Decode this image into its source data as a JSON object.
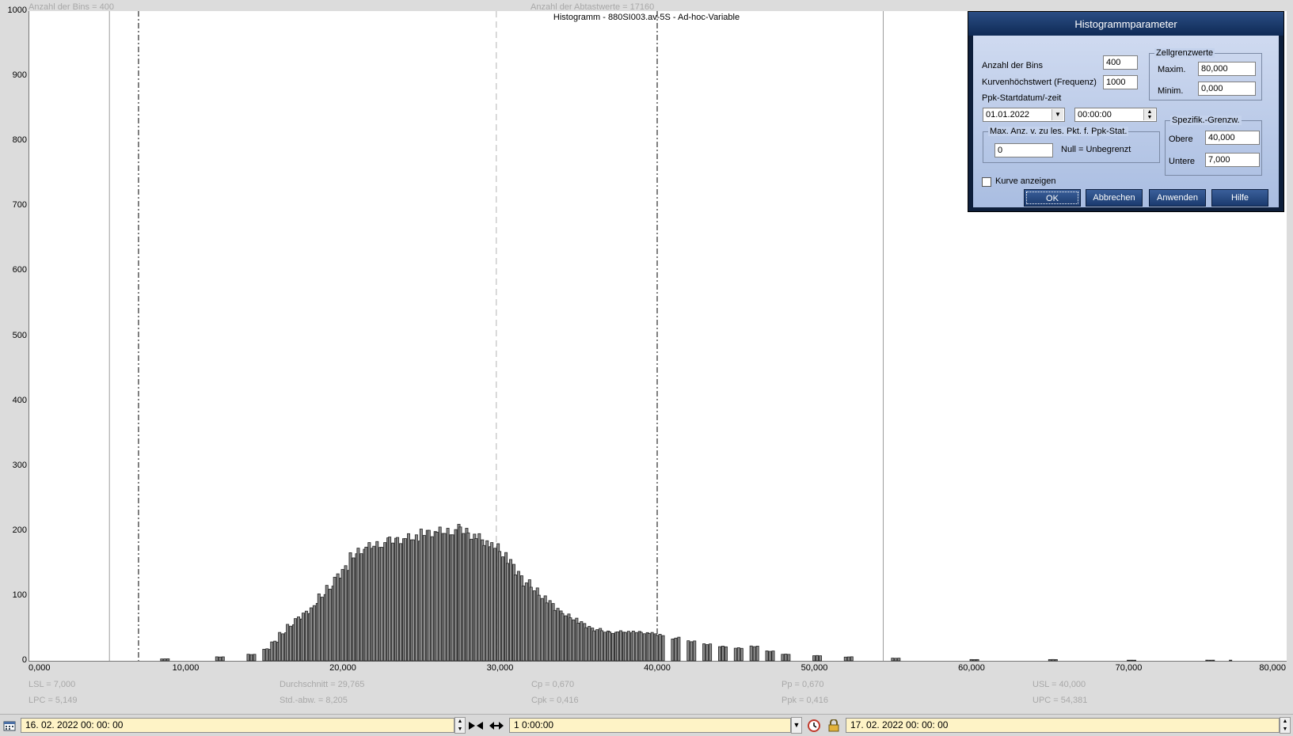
{
  "header": {
    "bins_info": "Anzahl der Bins =   400",
    "samples_info": "Anzahl der Abtastwerte = 17160",
    "title": "Histogramm - 880SI003.av-5S - Ad-hoc-Variable"
  },
  "stats": {
    "lsl": "LSL = 7,000",
    "lpc": "LPC = 5,149",
    "mean": "Durchschnitt  = 29,765",
    "std": "Std.-abw. = 8,205",
    "cp": "Cp  = 0,670",
    "cpk": "Cpk = 0,416",
    "pp": "Pp  = 0,670",
    "ppk": "Ppk = 0,416",
    "usl": "USL = 40,000",
    "upc": "UPC = 54,381"
  },
  "chart_data": {
    "type": "bar",
    "title": "Histogramm - 880SI003.av-5S - Ad-hoc-Variable",
    "xlim": [
      0,
      80
    ],
    "ylim": [
      0,
      1000
    ],
    "x_ticks": [
      "0,000",
      "10,000",
      "20,000",
      "30,000",
      "40,000",
      "50,000",
      "60,000",
      "70,000",
      "80,000"
    ],
    "y_ticks": [
      "0",
      "100",
      "200",
      "300",
      "400",
      "500",
      "600",
      "700",
      "800",
      "900",
      "1000"
    ],
    "bin_width": 0.2,
    "markers": {
      "lsl": 7.0,
      "lpc": 5.149,
      "mean": 29.765,
      "usl": 40.0,
      "upc": 54.381
    },
    "series": [
      {
        "x_centers": [
          8.5,
          12.0,
          14.0,
          15.0,
          15.5,
          16.0,
          16.5,
          17.0,
          17.5,
          18.0,
          18.5,
          19.0,
          19.5,
          20.0,
          20.5,
          21.0,
          21.5,
          22.0,
          22.5,
          23.0,
          23.5,
          24.0,
          24.5,
          25.0,
          25.5,
          26.0,
          26.5,
          27.0,
          27.5,
          28.0,
          28.5,
          29.0,
          29.5,
          30.0,
          30.5,
          31.0,
          31.5,
          32.0,
          32.5,
          33.0,
          33.5,
          34.0,
          34.5,
          35.0,
          35.5,
          36.0,
          36.5,
          37.0,
          37.5,
          38.0,
          38.5,
          39.0,
          39.5,
          40.0,
          41.0,
          42.0,
          43.0,
          44.0,
          45.0,
          46.0,
          47.0,
          48.0,
          50.0,
          52.0,
          55.0,
          60.0,
          65.0,
          70.0,
          75.0,
          76.5
        ],
        "values": [
          3,
          6,
          10,
          18,
          30,
          42,
          55,
          65,
          75,
          85,
          100,
          115,
          130,
          145,
          160,
          170,
          175,
          180,
          182,
          185,
          188,
          190,
          192,
          195,
          197,
          198,
          200,
          202,
          200,
          195,
          190,
          183,
          175,
          165,
          150,
          135,
          120,
          110,
          100,
          90,
          80,
          70,
          65,
          58,
          52,
          48,
          45,
          44,
          45,
          45,
          44,
          43,
          42,
          40,
          35,
          30,
          26,
          22,
          20,
          22,
          15,
          10,
          8,
          6,
          4,
          2,
          2,
          1,
          1,
          1
        ]
      }
    ]
  },
  "dialog": {
    "title": "Histogrammparameter",
    "bins_label": "Anzahl der Bins",
    "bins_value": "400",
    "curve_max_label": "Kurvenhöchstwert (Frequenz)",
    "curve_max_value": "1000",
    "ppk_start_label": "Ppk-Startdatum/-zeit",
    "ppk_date": "01.01.2022",
    "ppk_time": "00:00:00",
    "cell_limits_group": "Zellgrenzwerte",
    "max_label": "Maxim.",
    "max_value": "80,000",
    "min_label": "Minim.",
    "min_value": "0,000",
    "spec_limits_group": "Spezifik.-Grenzw.",
    "upper_label": "Obere",
    "upper_value": "40,000",
    "lower_label": "Untere",
    "lower_value": "7,000",
    "max_points_group": "Max. Anz. v. zu les. Pkt. f. Ppk-Stat.",
    "max_points_value": "0",
    "null_hint": "Null = Unbegrenzt",
    "show_curve_label": "Kurve anzeigen",
    "ok_label": "OK",
    "cancel_label": "Abbrechen",
    "apply_label": "Anwenden",
    "help_label": "Hilfe"
  },
  "toolbar": {
    "start_time": "16. 02. 2022   00: 00: 00",
    "duration": "1 0:00:00",
    "end_time": "17. 02. 2022   00: 00: 00"
  }
}
